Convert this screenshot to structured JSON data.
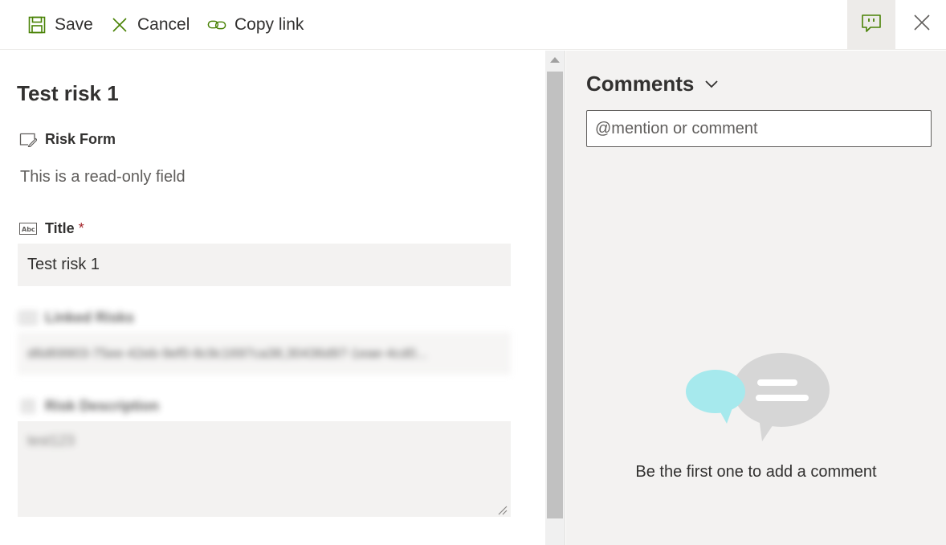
{
  "toolbar": {
    "save_label": "Save",
    "cancel_label": "Cancel",
    "copy_link_label": "Copy link"
  },
  "form": {
    "title": "Test risk 1",
    "risk_form": {
      "label": "Risk Form",
      "note": "This is a read-only field"
    },
    "title_field": {
      "label": "Title",
      "required_marker": "*",
      "value": "Test risk 1"
    },
    "linked_risks": {
      "label": "Linked Risks",
      "value": "d6d69903-75ee-42eb-9ef0-8c9c1697ca38,30436d97-1eae-4cd0..."
    },
    "risk_description": {
      "label": "Risk Description",
      "value": "test123"
    }
  },
  "comments": {
    "header": "Comments",
    "input_placeholder": "@mention or comment",
    "empty_message": "Be the first one to add a comment"
  },
  "colors": {
    "accent_green": "#498205",
    "pane_background": "#f3f2f1",
    "bubble_teal": "#a6e9ed",
    "bubble_gray": "#d6d6d6"
  },
  "icons": {
    "save": "save-icon",
    "cancel": "cancel-icon",
    "copy_link": "link-icon",
    "comments_toggle": "comment-icon",
    "close": "close-icon"
  }
}
